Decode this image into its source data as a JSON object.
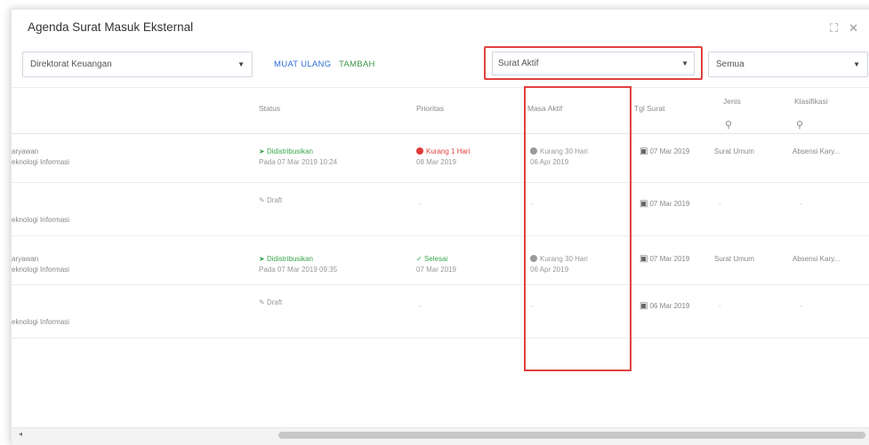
{
  "window": {
    "title": "Agenda Surat Masuk Eksternal",
    "expand_icon": "expand-icon",
    "close_icon": "close-icon"
  },
  "filters": {
    "direktorat": "Direktorat Keuangan",
    "muat_ulang": "MUAT ULANG",
    "tambah": "TAMBAH",
    "status_aktif": "Surat Aktif",
    "semua": "Semua"
  },
  "columns": {
    "status": "Status",
    "prioritas": "Prioritas",
    "masa_aktif": "Masa Aktif",
    "tgl_surat": "Tgl Surat",
    "jenis": "Jenis",
    "klasifikasi": "Klasifikasi"
  },
  "rows": [
    {
      "left1": "aryawan",
      "left2": "eknologi Informasi",
      "status": "Didistribusikan",
      "status_sub": "Pada 07 Mar 2019 10:24",
      "prioritas": "Kurang 1 Hari",
      "prioritas_sub": "08 Mar 2019",
      "masa": "Kurang 30 Hari",
      "masa_sub": "06 Apr 2019",
      "tgl": "07 Mar 2019",
      "jenis": "Surat Umum",
      "klasifikasi": "Absensi Kary..."
    },
    {
      "left1": "",
      "left2": "eknologi Informasi",
      "status": "Draft",
      "status_sub": "",
      "prioritas": "-",
      "prioritas_sub": "",
      "masa": "-",
      "masa_sub": "",
      "tgl": "07 Mar 2019",
      "jenis": "-",
      "klasifikasi": "-"
    },
    {
      "left1": "aryawan",
      "left2": "eknologi Informasi",
      "status": "Didistribusikan",
      "status_sub": "Pada 07 Mar 2019 09:35",
      "prioritas": "Selesai",
      "prioritas_sub": "07 Mar 2019",
      "masa": "Kurang 30 Hari",
      "masa_sub": "06 Apr 2019",
      "tgl": "07 Mar 2019",
      "jenis": "Surat Umum",
      "klasifikasi": "Absensi Kary..."
    },
    {
      "left1": "",
      "left2": "eknologi Informasi",
      "status": "Draft",
      "status_sub": "",
      "prioritas": "-",
      "prioritas_sub": "",
      "masa": "-",
      "masa_sub": "",
      "tgl": "06 Mar 2019",
      "jenis": "-",
      "klasifikasi": "-"
    }
  ],
  "colors": {
    "accent_blue": "#2f6fd6",
    "accent_green": "#3a9a48",
    "highlight_red": "#e24040"
  }
}
